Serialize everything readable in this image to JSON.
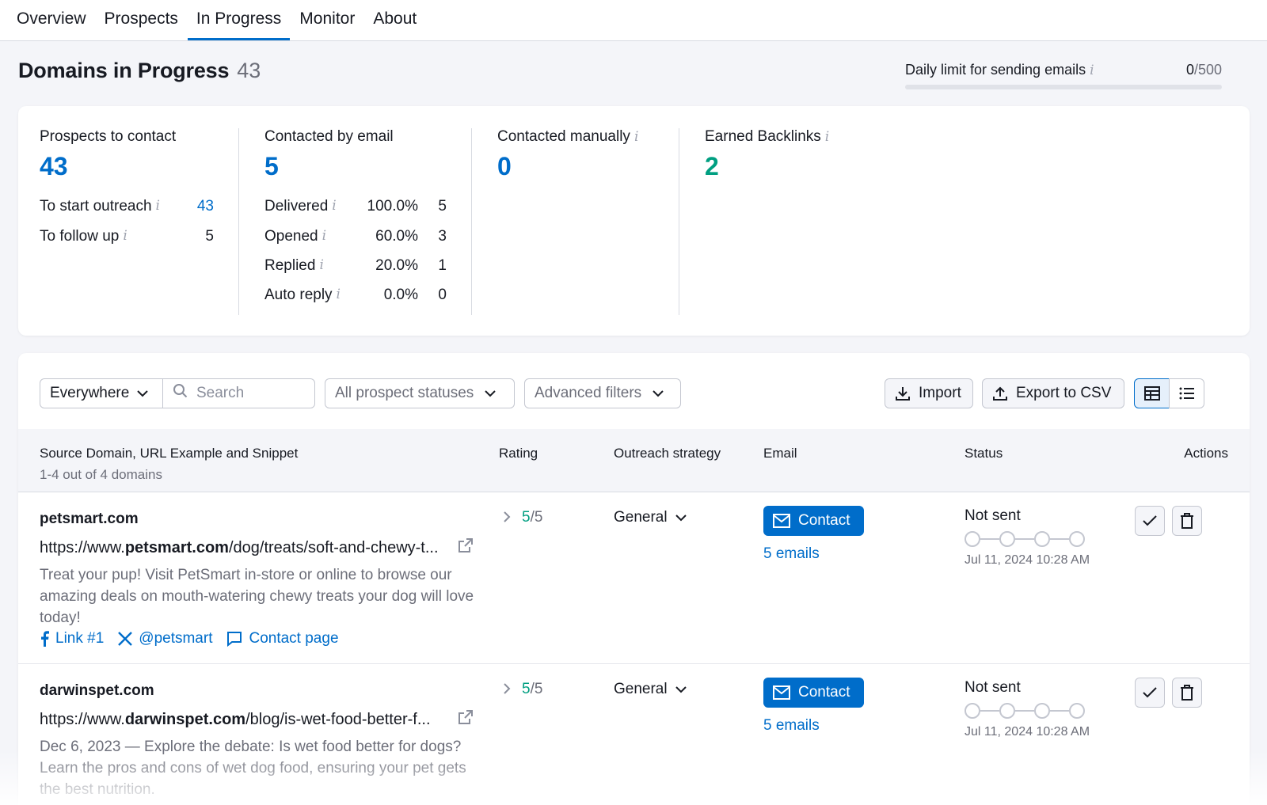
{
  "nav": {
    "tabs": [
      {
        "label": "Overview"
      },
      {
        "label": "Prospects"
      },
      {
        "label": "In Progress"
      },
      {
        "label": "Monitor"
      },
      {
        "label": "About"
      }
    ]
  },
  "header": {
    "title": "Domains in Progress",
    "count": "43",
    "daily_label": "Daily limit for sending emails",
    "daily_used": "0",
    "daily_total": "/500"
  },
  "stats": {
    "prospects": {
      "label": "Prospects to contact",
      "value": "43",
      "rows": [
        {
          "label": "To start outreach",
          "num": "43"
        },
        {
          "label": "To follow up",
          "num": "5"
        }
      ]
    },
    "email": {
      "label": "Contacted by email",
      "value": "5",
      "rows": [
        {
          "label": "Delivered",
          "pct": "100.0%",
          "num": "5"
        },
        {
          "label": "Opened",
          "pct": "60.0%",
          "num": "3"
        },
        {
          "label": "Replied",
          "pct": "20.0%",
          "num": "1"
        },
        {
          "label": "Auto reply",
          "pct": "0.0%",
          "num": "0"
        }
      ]
    },
    "manual": {
      "label": "Contacted manually",
      "value": "0"
    },
    "backlinks": {
      "label": "Earned Backlinks",
      "value": "2"
    }
  },
  "filters": {
    "scope": "Everywhere",
    "search_placeholder": "Search",
    "status": "All prospect statuses",
    "advanced": "Advanced filters",
    "import": "Import",
    "export": "Export to CSV"
  },
  "table": {
    "columns": {
      "source": "Source Domain, URL Example and Snippet",
      "rating": "Rating",
      "strategy": "Outreach strategy",
      "email": "Email",
      "status": "Status",
      "actions": "Actions"
    },
    "subheader": "1-4 out of 4 domains",
    "rows": [
      {
        "domain": "petsmart.com",
        "url_prefix": "https://www.",
        "url_bold": "petsmart.com",
        "url_suffix": "/dog/treats/soft-and-chewy-t...",
        "snippet": "Treat your pup! Visit PetSmart in-store or online to browse our amazing deals on mouth-watering chewy treats your dog will love today!",
        "links": {
          "facebook": "Link #1",
          "x": "@petsmart",
          "contact": "Contact page"
        },
        "rating": "5",
        "rating_of": "/5",
        "strategy": "General",
        "contact_label": "Contact",
        "emails": "5 emails",
        "status": "Not sent",
        "date": "Jul 11, 2024 10:28 AM"
      },
      {
        "domain": "darwinspet.com",
        "url_prefix": "https://www.",
        "url_bold": "darwinspet.com",
        "url_suffix": "/blog/is-wet-food-better-f...",
        "snippet": "Dec 6, 2023 — Explore the debate: Is wet food better for dogs? Learn the pros and cons of wet dog food, ensuring your pet gets the best nutrition.",
        "rating": "5",
        "rating_of": "/5",
        "strategy": "General",
        "contact_label": "Contact",
        "emails": "5 emails",
        "status": "Not sent",
        "date": "Jul 11, 2024 10:28 AM"
      }
    ]
  },
  "colors": {
    "accent": "#006dca",
    "success": "#009f81"
  }
}
